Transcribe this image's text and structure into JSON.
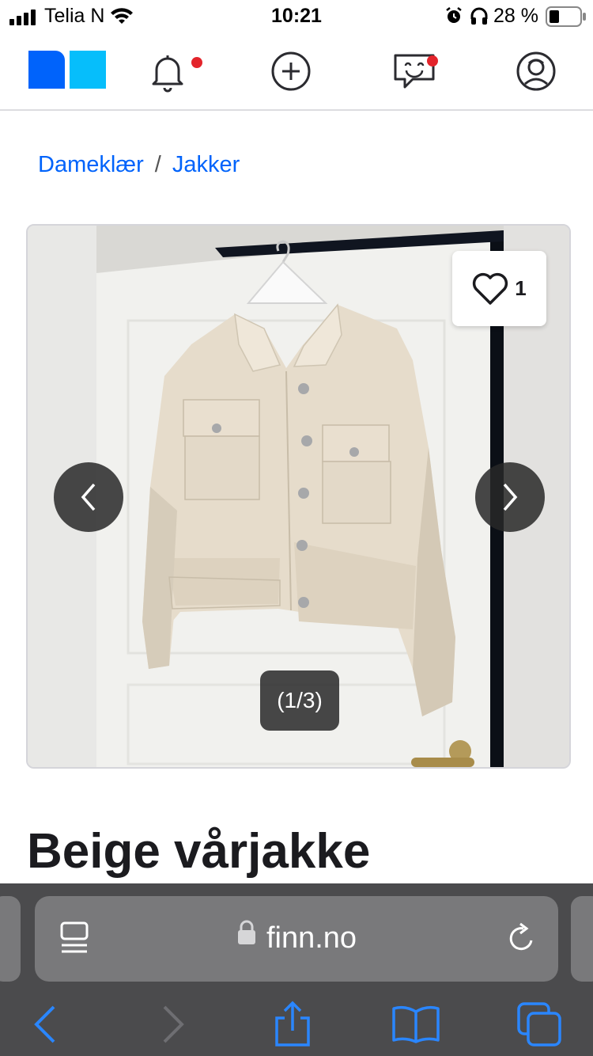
{
  "status_bar": {
    "carrier": "Telia N",
    "time": "10:21",
    "battery_percent": "28 %"
  },
  "header": {
    "logo": "finn-logo",
    "icons": [
      "bell-icon",
      "plus-circle-icon",
      "chat-icon",
      "profile-icon"
    ],
    "notification_color": "#e3242b"
  },
  "breadcrumb": {
    "items": [
      "Dameklær",
      "Jakker"
    ],
    "separator": "/"
  },
  "gallery": {
    "favorite_count": "1",
    "counter": "(1/3)"
  },
  "listing": {
    "title": "Beige vårjakke"
  },
  "browser": {
    "url": "finn.no"
  },
  "colors": {
    "link": "#0063fb",
    "brand_dark": "#0063fb",
    "brand_light": "#06befb",
    "safari_accent": "#2a86ff"
  }
}
